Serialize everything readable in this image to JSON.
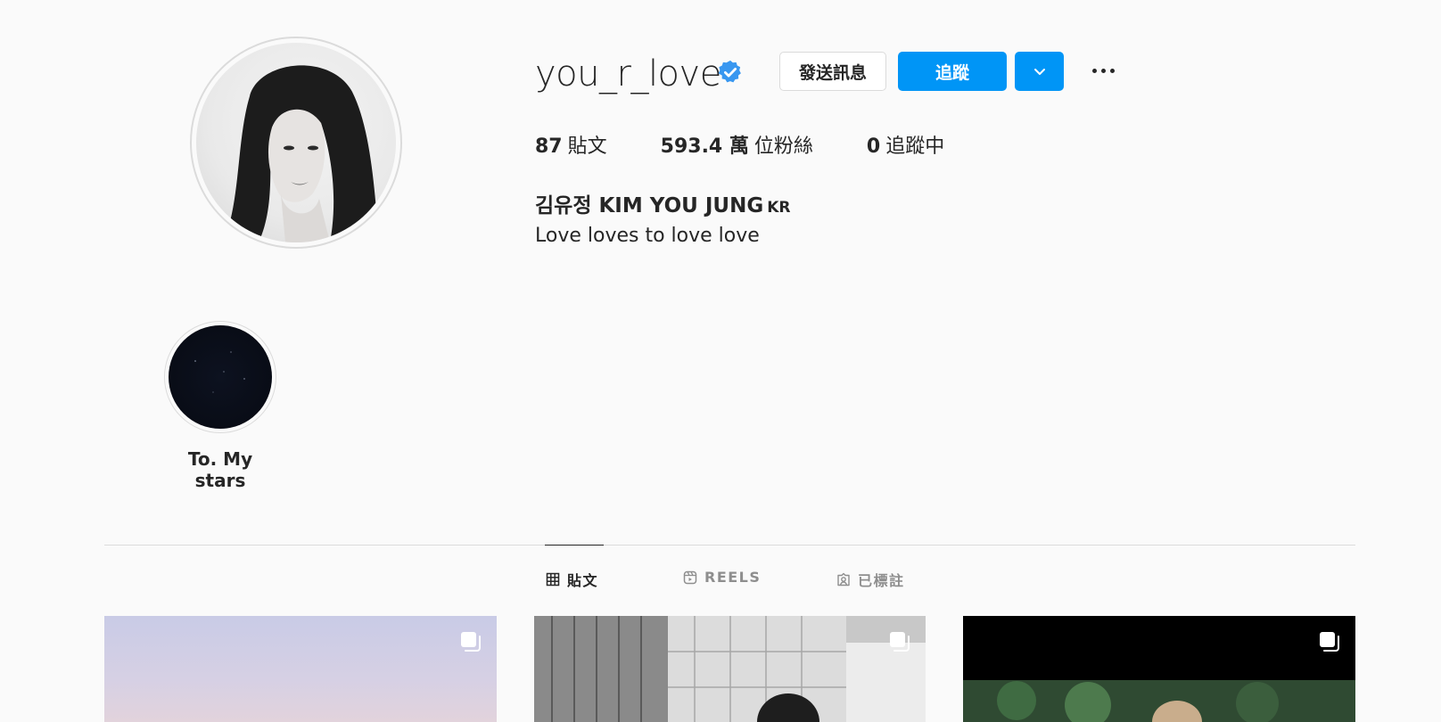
{
  "profile": {
    "username": "you_r_love",
    "verified": true,
    "full_name": "김유정 KIM YOU JUNG",
    "full_name_suffix": "KR",
    "bio": "Love loves to love love"
  },
  "buttons": {
    "message": "發送訊息",
    "follow": "追蹤"
  },
  "stats": {
    "posts_count": "87",
    "posts_label": "貼文",
    "followers_count": "593.4 萬",
    "followers_label": "位粉絲",
    "following_count": "0",
    "following_label": "追蹤中"
  },
  "highlights": [
    {
      "label": "To. My stars"
    }
  ],
  "tabs": [
    {
      "label": "貼文",
      "icon": "grid-icon",
      "active": true
    },
    {
      "label": "REELS",
      "icon": "reels-icon",
      "active": false
    },
    {
      "label": "已標註",
      "icon": "tagged-icon",
      "active": false
    }
  ],
  "colors": {
    "accent": "#0095f6",
    "verified": "#3897f0",
    "text": "#262626",
    "muted": "#8e8e8e",
    "border": "#dbdbdb"
  }
}
